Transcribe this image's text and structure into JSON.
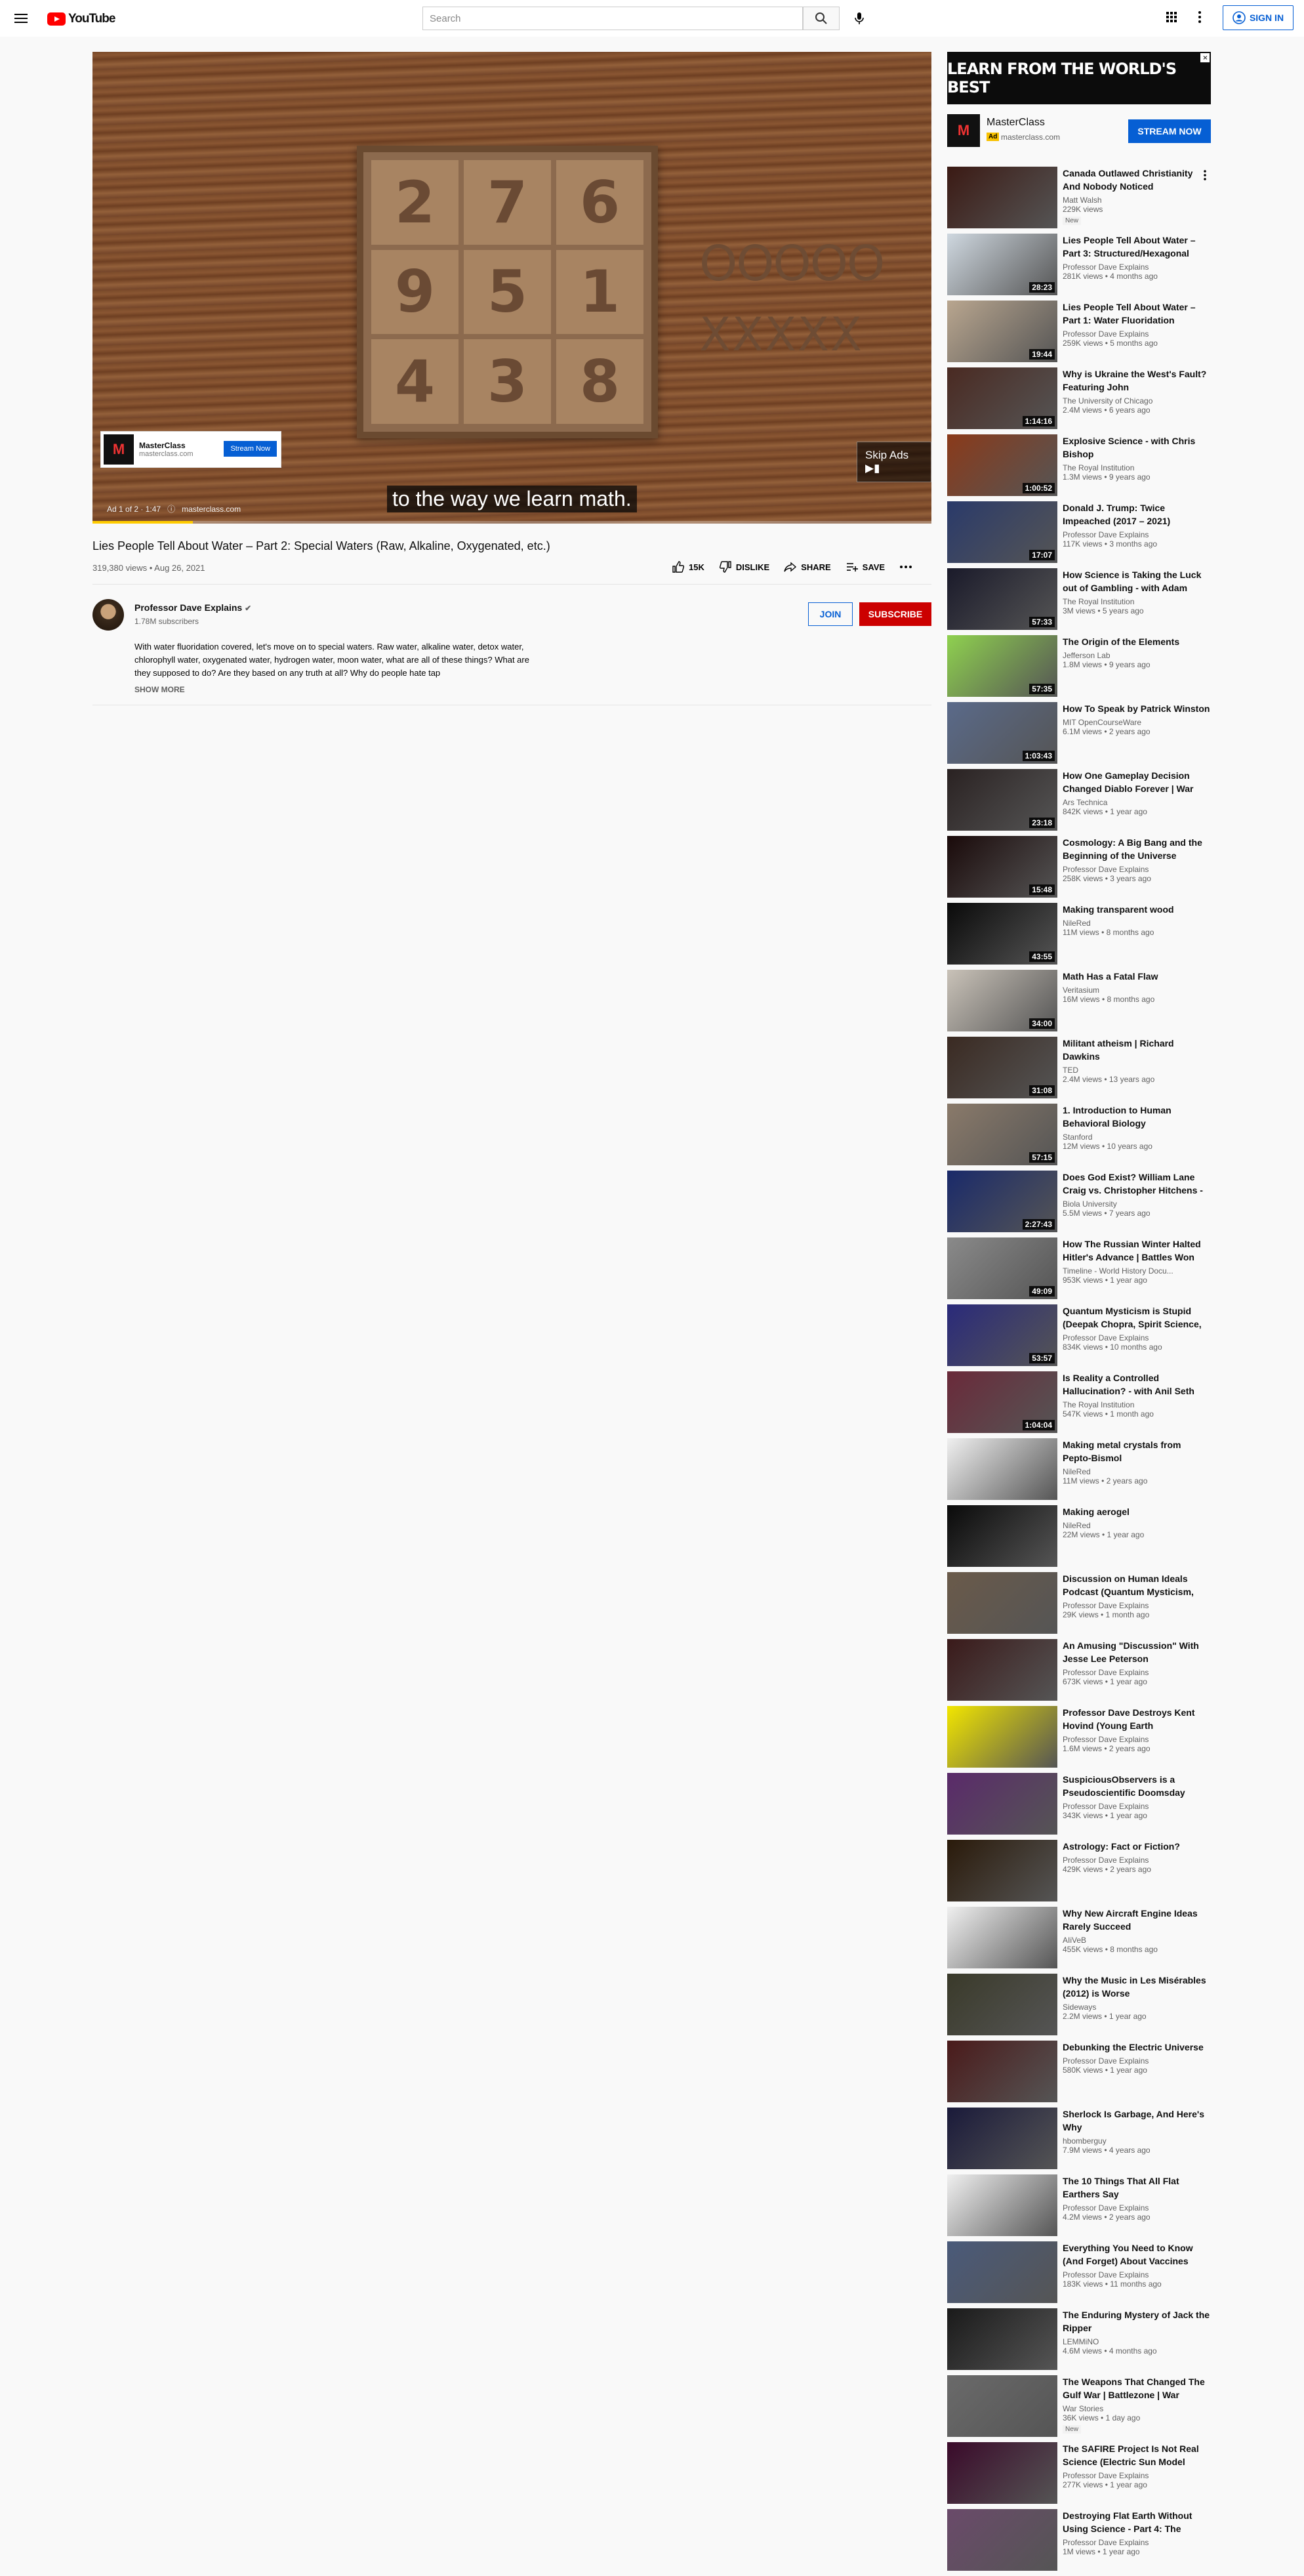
{
  "header": {
    "logo_text": "YouTube",
    "search_placeholder": "Search",
    "signin_label": "SIGN IN"
  },
  "player": {
    "board_digits": [
      "2",
      "7",
      "6",
      "9",
      "5",
      "1",
      "4",
      "3",
      "8"
    ],
    "os_row": "OOOOO",
    "xs_row": "XXXXX",
    "caption": "to the way we learn math.",
    "ad": {
      "brand": "MasterClass",
      "domain": "masterclass.com",
      "cta": "Stream Now",
      "skip_label": "Skip Ads",
      "ad_counter": "Ad 1 of 2 · 1:47",
      "ad_domain": "masterclass.com"
    },
    "progress_fraction": 0.12
  },
  "video": {
    "title": "Lies People Tell About Water – Part 2: Special Waters (Raw, Alkaline, Oxygenated, etc.)",
    "meta": "319,380 views • Aug 26, 2021",
    "likes": "15K",
    "dislike_label": "DISLIKE",
    "share_label": "SHARE",
    "save_label": "SAVE"
  },
  "channel": {
    "name": "Professor Dave Explains",
    "subscribers": "1.78M subscribers",
    "join_label": "JOIN",
    "subscribe_label": "SUBSCRIBE",
    "description": "With water fluoridation covered, let's move on to special waters. Raw water, alkaline water, detox water, chlorophyll water, oxygenated water, hydrogen water, moon water, what are all of these things? What are they supposed to do? Are they based on any truth at all? Why do people hate tap",
    "show_more": "SHOW MORE"
  },
  "sidebar_ad": {
    "banner_text": "LEARN FROM THE WORLD'S BEST",
    "brand": "MasterClass",
    "ad_badge": "Ad",
    "domain": "masterclass.com",
    "cta": "STREAM NOW"
  },
  "related": [
    {
      "title": "Canada Outlawed Christianity And Nobody Noticed",
      "channel": "Matt Walsh",
      "views": "229K views",
      "duration": "",
      "thumb": "#3b1a14",
      "badge": "New"
    },
    {
      "title": "Lies People Tell About Water – Part 3: Structured/Hexagonal",
      "channel": "Professor Dave Explains",
      "views": "281K views • 4 months ago",
      "duration": "28:23",
      "thumb": "#cfd8e0",
      "badge": ""
    },
    {
      "title": "Lies People Tell About Water – Part 1: Water Fluoridation",
      "channel": "Professor Dave Explains",
      "views": "259K views • 5 months ago",
      "duration": "19:44",
      "thumb": "#b9a68f",
      "badge": ""
    },
    {
      "title": "Why is Ukraine the West's Fault? Featuring John",
      "channel": "The University of Chicago",
      "views": "2.4M views • 6 years ago",
      "duration": "1:14:16",
      "thumb": "#4a2a22",
      "badge": ""
    },
    {
      "title": "Explosive Science - with Chris Bishop",
      "channel": "The Royal Institution",
      "views": "1.3M views • 9 years ago",
      "duration": "1:00:52",
      "thumb": "#8a3a1a",
      "badge": ""
    },
    {
      "title": "Donald J. Trump: Twice Impeached (2017 – 2021)",
      "channel": "Professor Dave Explains",
      "views": "117K views • 3 months ago",
      "duration": "17:07",
      "thumb": "#2a3a6a",
      "badge": ""
    },
    {
      "title": "How Science is Taking the Luck out of Gambling - with Adam",
      "channel": "The Royal Institution",
      "views": "3M views • 5 years ago",
      "duration": "57:33",
      "thumb": "#1a1a2a",
      "badge": ""
    },
    {
      "title": "The Origin of the Elements",
      "channel": "Jefferson Lab",
      "views": "1.8M views • 9 years ago",
      "duration": "57:35",
      "thumb": "#8fd14f",
      "badge": ""
    },
    {
      "title": "How To Speak by Patrick Winston",
      "channel": "MIT OpenCourseWare",
      "views": "6.1M views • 2 years ago",
      "duration": "1:03:43",
      "thumb": "#5a6a8a",
      "badge": ""
    },
    {
      "title": "How One Gameplay Decision Changed Diablo Forever | War",
      "channel": "Ars Technica",
      "views": "842K views • 1 year ago",
      "duration": "23:18",
      "thumb": "#2a2222",
      "badge": ""
    },
    {
      "title": "Cosmology: A Big Bang and the Beginning of the Universe",
      "channel": "Professor Dave Explains",
      "views": "258K views • 3 years ago",
      "duration": "15:48",
      "thumb": "#1a0a0a",
      "badge": ""
    },
    {
      "title": "Making transparent wood",
      "channel": "NileRed",
      "views": "11M views • 8 months ago",
      "duration": "43:55",
      "thumb": "#0a0a0a",
      "badge": ""
    },
    {
      "title": "Math Has a Fatal Flaw",
      "channel": "Veritasium",
      "views": "16M views • 8 months ago",
      "duration": "34:00",
      "thumb": "#c9c2b8",
      "badge": ""
    },
    {
      "title": "Militant atheism | Richard Dawkins",
      "channel": "TED",
      "views": "2.4M views • 13 years ago",
      "duration": "31:08",
      "thumb": "#3a2a22",
      "badge": ""
    },
    {
      "title": "1. Introduction to Human Behavioral Biology",
      "channel": "Stanford",
      "views": "12M views • 10 years ago",
      "duration": "57:15",
      "thumb": "#8a7a6a",
      "badge": ""
    },
    {
      "title": "Does God Exist? William Lane Craig vs. Christopher Hitchens -",
      "channel": "Biola University",
      "views": "5.5M views • 7 years ago",
      "duration": "2:27:43",
      "thumb": "#1a2a6a",
      "badge": ""
    },
    {
      "title": "How The Russian Winter Halted Hitler's Advance | Battles Won",
      "channel": "Timeline - World History Docu...",
      "views": "953K views • 1 year ago",
      "duration": "49:09",
      "thumb": "#8a8a8a",
      "badge": ""
    },
    {
      "title": "Quantum Mysticism is Stupid (Deepak Chopra, Spirit Science,",
      "channel": "Professor Dave Explains",
      "views": "834K views • 10 months ago",
      "duration": "53:57",
      "thumb": "#2a2a7a",
      "badge": ""
    },
    {
      "title": "Is Reality a Controlled Hallucination? - with Anil Seth",
      "channel": "The Royal Institution",
      "views": "547K views • 1 month ago",
      "duration": "1:04:04",
      "thumb": "#6a2a3a",
      "badge": ""
    },
    {
      "title": "Making metal crystals from Pepto-Bismol",
      "channel": "NileRed",
      "views": "11M views • 2 years ago",
      "duration": "",
      "thumb": "#f0f0f0",
      "badge": ""
    },
    {
      "title": "Making aerogel",
      "channel": "NileRed",
      "views": "22M views • 1 year ago",
      "duration": "",
      "thumb": "#0a0a0a",
      "badge": ""
    },
    {
      "title": "Discussion on Human Ideals Podcast (Quantum Mysticism,",
      "channel": "Professor Dave Explains",
      "views": "29K views • 1 month ago",
      "duration": "",
      "thumb": "#6a5a4a",
      "badge": ""
    },
    {
      "title": "An Amusing \"Discussion\" With Jesse Lee Peterson",
      "channel": "Professor Dave Explains",
      "views": "673K views • 1 year ago",
      "duration": "",
      "thumb": "#3a1a1a",
      "badge": ""
    },
    {
      "title": "Professor Dave Destroys Kent Hovind (Young Earth",
      "channel": "Professor Dave Explains",
      "views": "1.6M views • 2 years ago",
      "duration": "",
      "thumb": "#f2e600",
      "badge": ""
    },
    {
      "title": "SuspiciousObservers is a Pseudoscientific Doomsday",
      "channel": "Professor Dave Explains",
      "views": "343K views • 1 year ago",
      "duration": "",
      "thumb": "#5a2a6a",
      "badge": ""
    },
    {
      "title": "Astrology: Fact or Fiction?",
      "channel": "Professor Dave Explains",
      "views": "429K views • 2 years ago",
      "duration": "",
      "thumb": "#2a1a0a",
      "badge": ""
    },
    {
      "title": "Why New Aircraft Engine Ideas Rarely Succeed",
      "channel": "AIiVeB",
      "views": "455K views • 8 months ago",
      "duration": "",
      "thumb": "#f0f0f0",
      "badge": ""
    },
    {
      "title": "Why the Music in Les Misérables (2012) is Worse",
      "channel": "Sideways",
      "views": "2.2M views • 1 year ago",
      "duration": "",
      "thumb": "#3a3a2a",
      "badge": ""
    },
    {
      "title": "Debunking the Electric Universe",
      "channel": "Professor Dave Explains",
      "views": "580K views • 1 year ago",
      "duration": "",
      "thumb": "#4a1a1a",
      "badge": ""
    },
    {
      "title": "Sherlock Is Garbage, And Here's Why",
      "channel": "hbomberguy",
      "views": "7.9M views • 4 years ago",
      "duration": "",
      "thumb": "#1a1a3a",
      "badge": ""
    },
    {
      "title": "The 10 Things That All Flat Earthers Say",
      "channel": "Professor Dave Explains",
      "views": "4.2M views • 2 years ago",
      "duration": "",
      "thumb": "#f0f0f0",
      "badge": ""
    },
    {
      "title": "Everything You Need to Know (And Forget) About Vaccines",
      "channel": "Professor Dave Explains",
      "views": "183K views • 11 months ago",
      "duration": "",
      "thumb": "#4a5a7a",
      "badge": ""
    },
    {
      "title": "The Enduring Mystery of Jack the Ripper",
      "channel": "LEMMiNO",
      "views": "4.6M views • 4 months ago",
      "duration": "",
      "thumb": "#1a1a1a",
      "badge": ""
    },
    {
      "title": "The Weapons That Changed The Gulf War | Battlezone | War",
      "channel": "War Stories",
      "views": "36K views • 1 day ago",
      "duration": "",
      "thumb": "#6a6a6a",
      "badge": "New"
    },
    {
      "title": "The SAFIRE Project Is Not Real Science (Electric Sun Model",
      "channel": "Professor Dave Explains",
      "views": "277K views • 1 year ago",
      "duration": "",
      "thumb": "#3a0a2a",
      "badge": ""
    },
    {
      "title": "Destroying Flat Earth Without Using Science - Part 4: The",
      "channel": "Professor Dave Explains",
      "views": "1M views • 1 year ago",
      "duration": "",
      "thumb": "#6a4a6a",
      "badge": ""
    }
  ]
}
